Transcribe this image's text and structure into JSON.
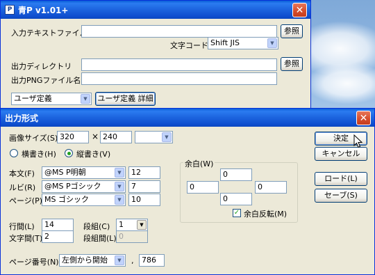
{
  "main_window": {
    "title": "青P  v1.01+",
    "input_file_label": "入力テキストファイル",
    "browse1": "参照",
    "charcode_label": "文字コード",
    "charcode_value": "Shift JIS",
    "output_dir_label": "出力ディレクトリ",
    "browse2": "参照",
    "png_name_label": "出力PNGファイル名",
    "preset_value": "ユーザ定義",
    "preset_detail_button": "ユーザ定義 詳細"
  },
  "dialog": {
    "title": "出力形式",
    "image_size_label": "画像サイズ(S)",
    "width": "320",
    "times": "×",
    "height": "240",
    "size_preset": "",
    "horizontal_label": "横書き(H)",
    "vertical_label": "縦書き(V)",
    "orientation": "vertical",
    "body_label": "本文(F)",
    "body_font": "@MS P明朝",
    "body_size": "12",
    "ruby_label": "ルビ(R)",
    "ruby_font": "@MS Pゴシック",
    "ruby_size": "7",
    "page_label": "ページ(P)",
    "page_font": "MS ゴシック",
    "page_size": "10",
    "margin_group": "余白(W)",
    "margin_top": "0",
    "margin_left": "0",
    "margin_right": "0",
    "margin_bottom": "0",
    "margin_flip_label": "余白反転(M)",
    "margin_flip_checked": true,
    "line_spacing_label": "行間(L)",
    "line_spacing": "14",
    "char_spacing_label": "文字間(T)",
    "char_spacing": "2",
    "columns_label": "段組(C)",
    "columns_value": "1",
    "column_gap_label": "段組間(L)",
    "column_gap": "0",
    "page_number_label": "ページ番号(N)",
    "page_number_mode": "左側から開始",
    "comma": ",",
    "page_number_offset": "786",
    "ok_button": "決定",
    "cancel_button": "キャンセル",
    "load_button": "ロード(L)",
    "save_button": "セーブ(S)"
  }
}
